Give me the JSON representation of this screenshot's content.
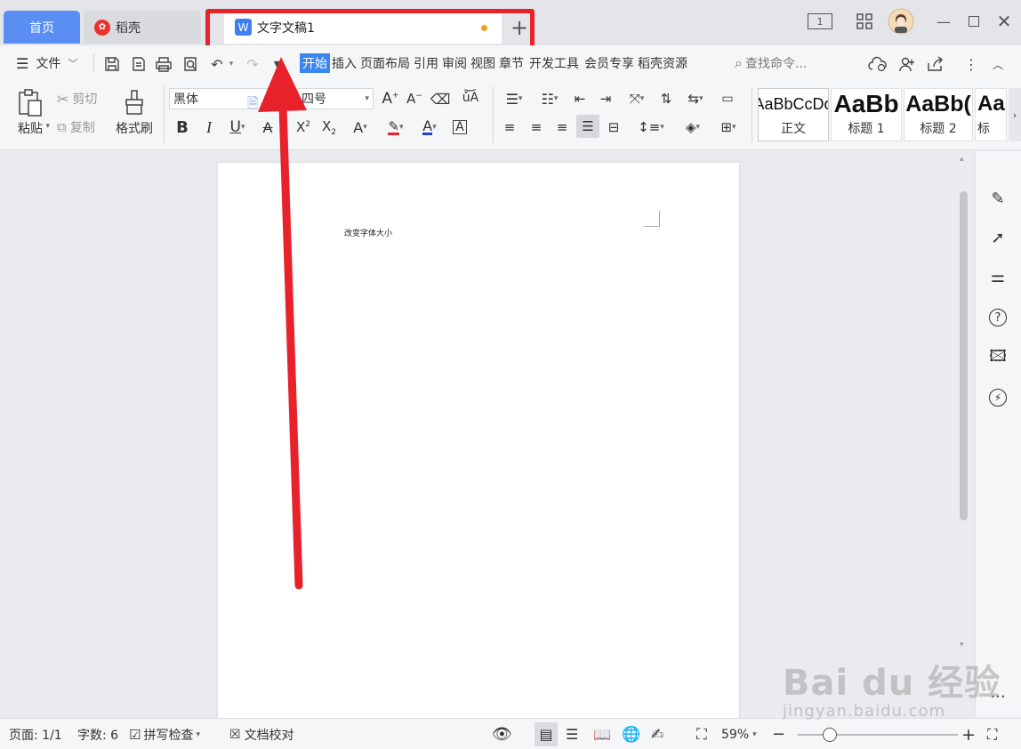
{
  "tabs": {
    "home": "首页",
    "daoke": "稻壳",
    "doc": "文字文稿1",
    "add": "+"
  },
  "window": {
    "page_indicator": "1"
  },
  "menu": {
    "file": "文件",
    "ribbon_tabs": [
      "开始",
      "插入",
      "页面布局",
      "引用",
      "审阅",
      "视图",
      "章节",
      "开发工具",
      "会员专享",
      "稻壳资源"
    ],
    "search_placeholder": "查找命令..."
  },
  "ribbon": {
    "paste": "粘贴",
    "cut": "剪切",
    "copy": "复制",
    "format_painter": "格式刷",
    "font_name": "黑体",
    "font_size": "四号",
    "styles": [
      {
        "sample": "AaBbCcDd",
        "name": "正文"
      },
      {
        "sample": "AaBb",
        "name": "标题 1"
      },
      {
        "sample": "AaBb(",
        "name": "标题 2"
      },
      {
        "sample": "AaBb",
        "name": "标"
      }
    ]
  },
  "document": {
    "text": "改变字体大小"
  },
  "status": {
    "page": "页面: 1/1",
    "words": "字数: 6",
    "spellcheck": "拼写检查",
    "proofread": "文档校对",
    "zoom": "59%",
    "zoom_level": 0.2
  },
  "watermark": {
    "main": "Bai du 经验",
    "sub": "jingyan.baidu.com"
  },
  "colors": {
    "accent": "#3d86f0",
    "annotation": "#e8222b",
    "highlight": "#e8222b",
    "font_color": "#1e3ed8"
  }
}
